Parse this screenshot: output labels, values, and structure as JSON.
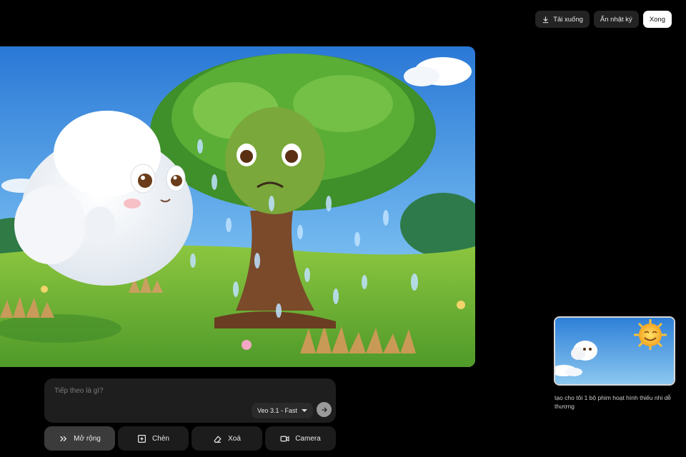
{
  "toolbar": {
    "download_label": "Tải xuống",
    "hide_log_label": "Ẩn nhật ký",
    "done_label": "Xong"
  },
  "prompt": {
    "placeholder": "Tiếp theo là gì?",
    "model_label": "Veo 3.1 - Fast"
  },
  "actions": {
    "extend_label": "Mở rộng",
    "insert_label": "Chèn",
    "remove_label": "Xoá",
    "camera_label": "Camera"
  },
  "history": {
    "caption": "tạo cho tôi 1 bộ phim hoạt hình thiếu nhi dễ thương"
  },
  "colors": {
    "background": "#000000",
    "panel": "#1e1e1e",
    "primary_button": "#ffffff"
  },
  "icons": {
    "download": "download-icon",
    "extend": "double-chevron-right-icon",
    "insert": "plus-square-icon",
    "remove": "eraser-icon",
    "camera": "video-camera-icon",
    "send": "arrow-right-icon"
  }
}
